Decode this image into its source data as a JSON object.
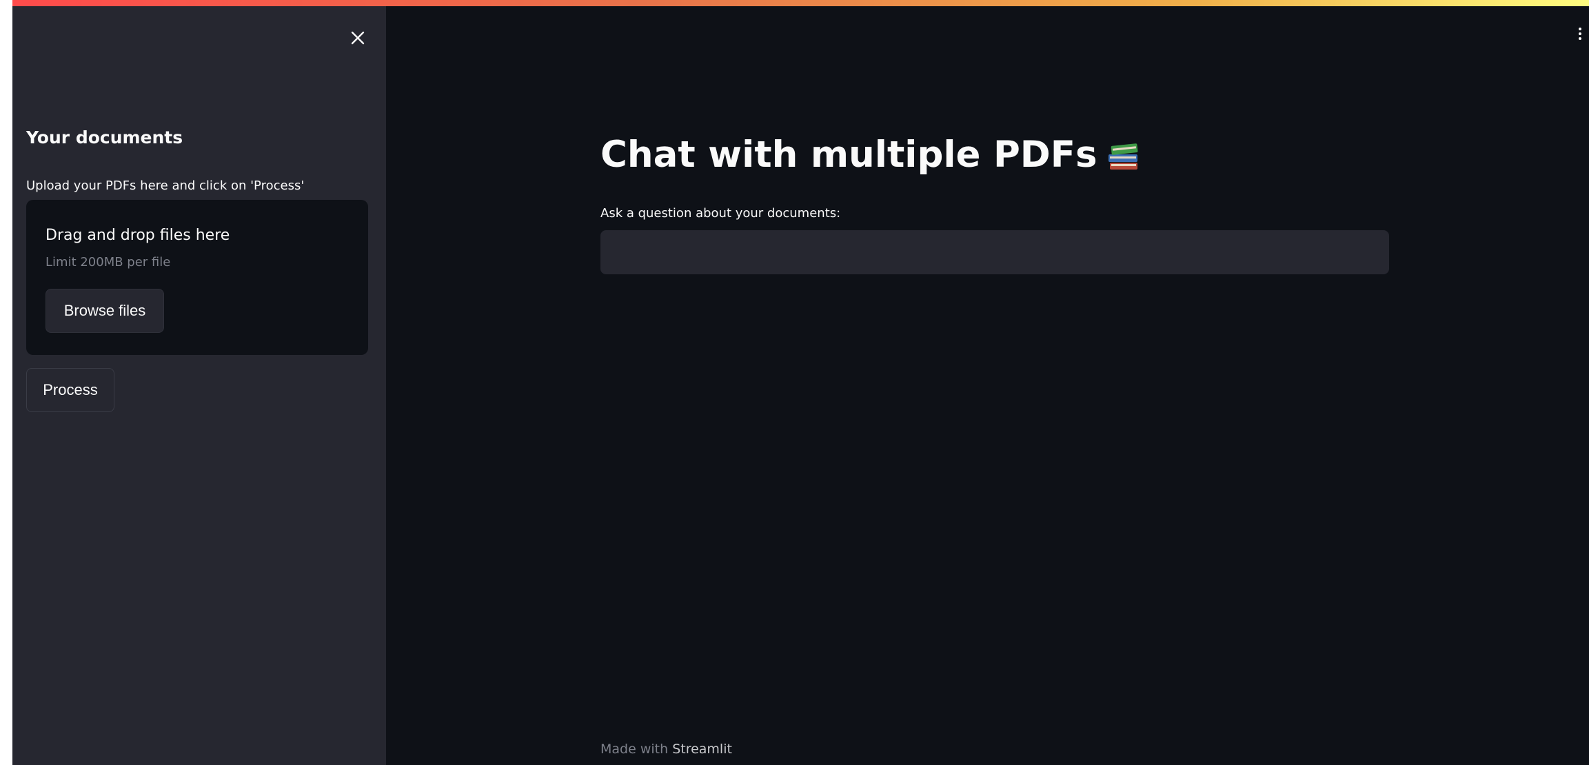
{
  "sidebar": {
    "title": "Your documents",
    "upload_label": "Upload your PDFs here and click on 'Process'",
    "dropzone": {
      "title": "Drag and drop files here",
      "limit": "Limit 200MB per file",
      "browse_label": "Browse files"
    },
    "process_label": "Process",
    "close_icon": "close-icon"
  },
  "main": {
    "title": "Chat with multiple PDFs",
    "title_icon": "books-icon",
    "question_label": "Ask a question about your documents:",
    "question_value": "",
    "menu_icon": "vertical-dots-icon"
  },
  "footer": {
    "prefix": "Made with",
    "link": "Streamlit"
  },
  "colors": {
    "background": "#0e1117",
    "sidebar": "#262730",
    "text": "#fafafa",
    "muted": "#7d808a"
  }
}
